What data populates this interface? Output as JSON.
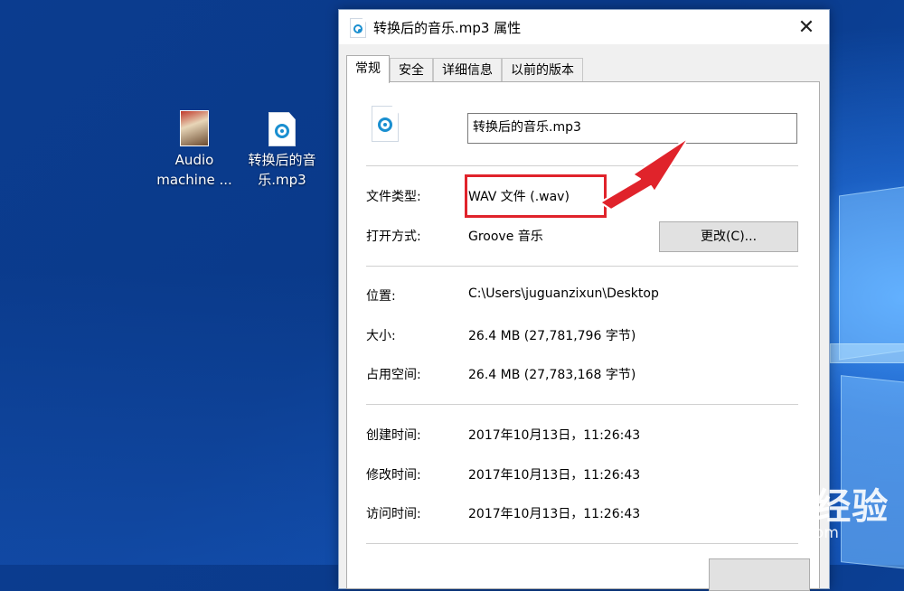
{
  "desktop": {
    "icons": [
      {
        "label": "Audio\nmachine ..."
      },
      {
        "label": "转换后的音\n乐.mp3"
      }
    ]
  },
  "dialog": {
    "title": "转换后的音乐.mp3 属性",
    "close_glyph": "✕",
    "tabs": [
      {
        "label": "常规",
        "active": true
      },
      {
        "label": "安全",
        "active": false
      },
      {
        "label": "详细信息",
        "active": false
      },
      {
        "label": "以前的版本",
        "active": false
      }
    ],
    "file_name": "转换后的音乐.mp3",
    "file_type_label": "文件类型:",
    "file_type_value": "WAV 文件 (.wav)",
    "open_with_label": "打开方式:",
    "open_with_value": "Groove 音乐",
    "change_button": "更改(C)...",
    "location_label": "位置:",
    "location_value": "C:\\Users\\juguanzixun\\Desktop",
    "size_label": "大小:",
    "size_value": "26.4 MB (27,781,796 字节)",
    "disk_size_label": "占用空间:",
    "disk_size_value": "26.4 MB (27,783,168 字节)",
    "created_label": "创建时间:",
    "created_value": "2017年10月13日，11:26:43",
    "modified_label": "修改时间:",
    "modified_value": "2017年10月13日，11:26:43",
    "accessed_label": "访问时间:",
    "accessed_value": "2017年10月13日，11:26:43"
  },
  "annotation": {
    "highlight_color": "#e0232b"
  },
  "watermark": {
    "main": "Baidu经验",
    "sub": "jingyan.baidu.com"
  },
  "colors": {
    "desktop": "#0b3c8f",
    "accent": "#1a8fd0"
  }
}
